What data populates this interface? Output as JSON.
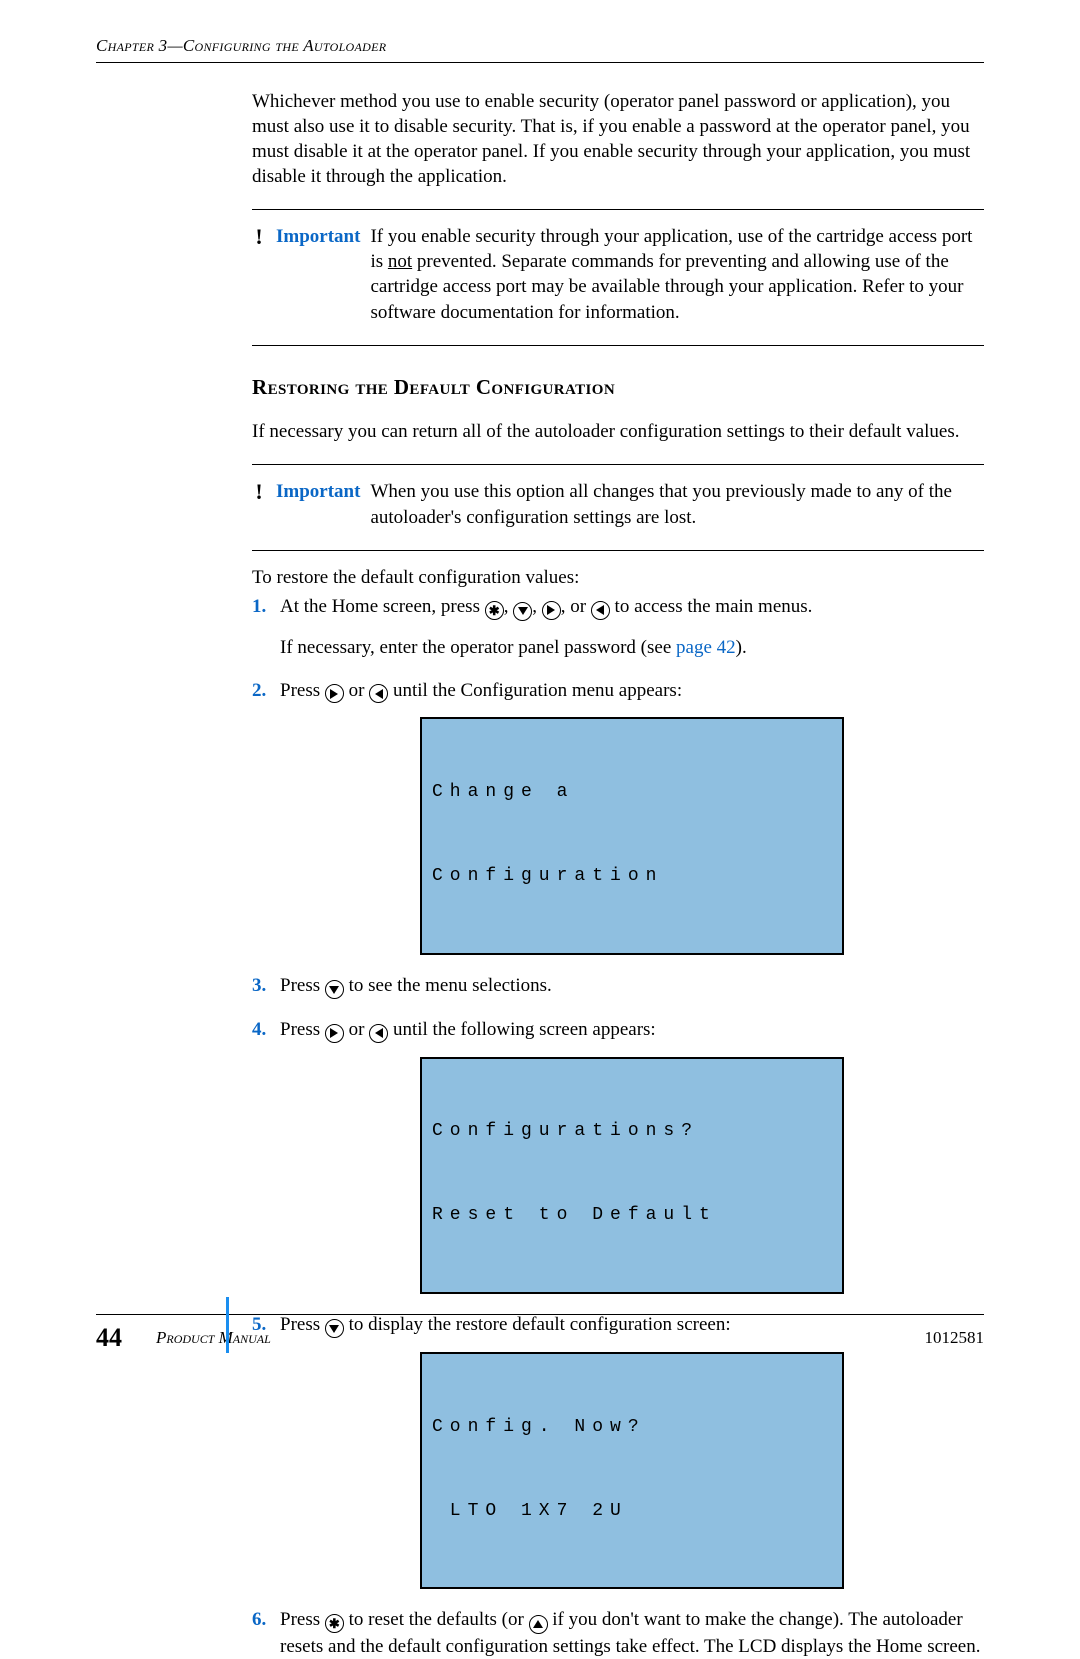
{
  "header": {
    "chapterLine": "Chapter 3—Configuring the Autoloader"
  },
  "intro": {
    "para": "Whichever method you use to enable security (operator panel password or application), you must also use it to disable security. That is, if you enable a password at the operator panel, you must disable it at the operator panel. If you enable security through your application, you must disable it through the application."
  },
  "important1": {
    "label": "Important",
    "pre": "If you enable security through your application, use of the cartridge access port is ",
    "underlined": "not",
    "post": " prevented. Separate commands for preventing and allowing use of the cartridge access port may be available through your application. Refer to your software documentation for information."
  },
  "section": {
    "title": "Restoring the Default Configuration"
  },
  "para2": "If necessary you can return all of the autoloader configuration settings to their default values.",
  "important2": {
    "label": "Important",
    "text": "When you use this option all changes that you previously made to any of the autoloader's configuration settings are lost."
  },
  "para3": "To restore the default configuration values:",
  "steps": {
    "s1a": "At the Home screen, press ",
    "s1b": " to access the main menus.",
    "s1c_pre": "If necessary, enter the operator panel password (see ",
    "s1c_link": "page 42",
    "s1c_post": ").",
    "s2a": "Press ",
    "s2b": " until the Configuration menu appears:",
    "s3a": "Press ",
    "s3b": " to see the menu selections.",
    "s4a": "Press ",
    "s4b": " until the following screen appears:",
    "s5a": "Press ",
    "s5b": " to display the restore default configuration screen:",
    "s6a": "Press ",
    "s6b": " to reset the defaults (or ",
    "s6c": " if you don't want to make the change). The autoloader resets and the default configuration settings take effect. The LCD displays the Home screen."
  },
  "lcd1": {
    "line1": "Change a",
    "line2": "Configuration"
  },
  "lcd2": {
    "line1": "Configurations?",
    "line2": "Reset to Default"
  },
  "lcd3": {
    "line1": "Config. Now?",
    "line2": " LTO 1X7 2U"
  },
  "sep": {
    "comma": ", ",
    "or": ", or ",
    "or2": " or "
  },
  "footer": {
    "pageNumber": "44",
    "label": "Product Manual",
    "docNumber": "1012581"
  }
}
